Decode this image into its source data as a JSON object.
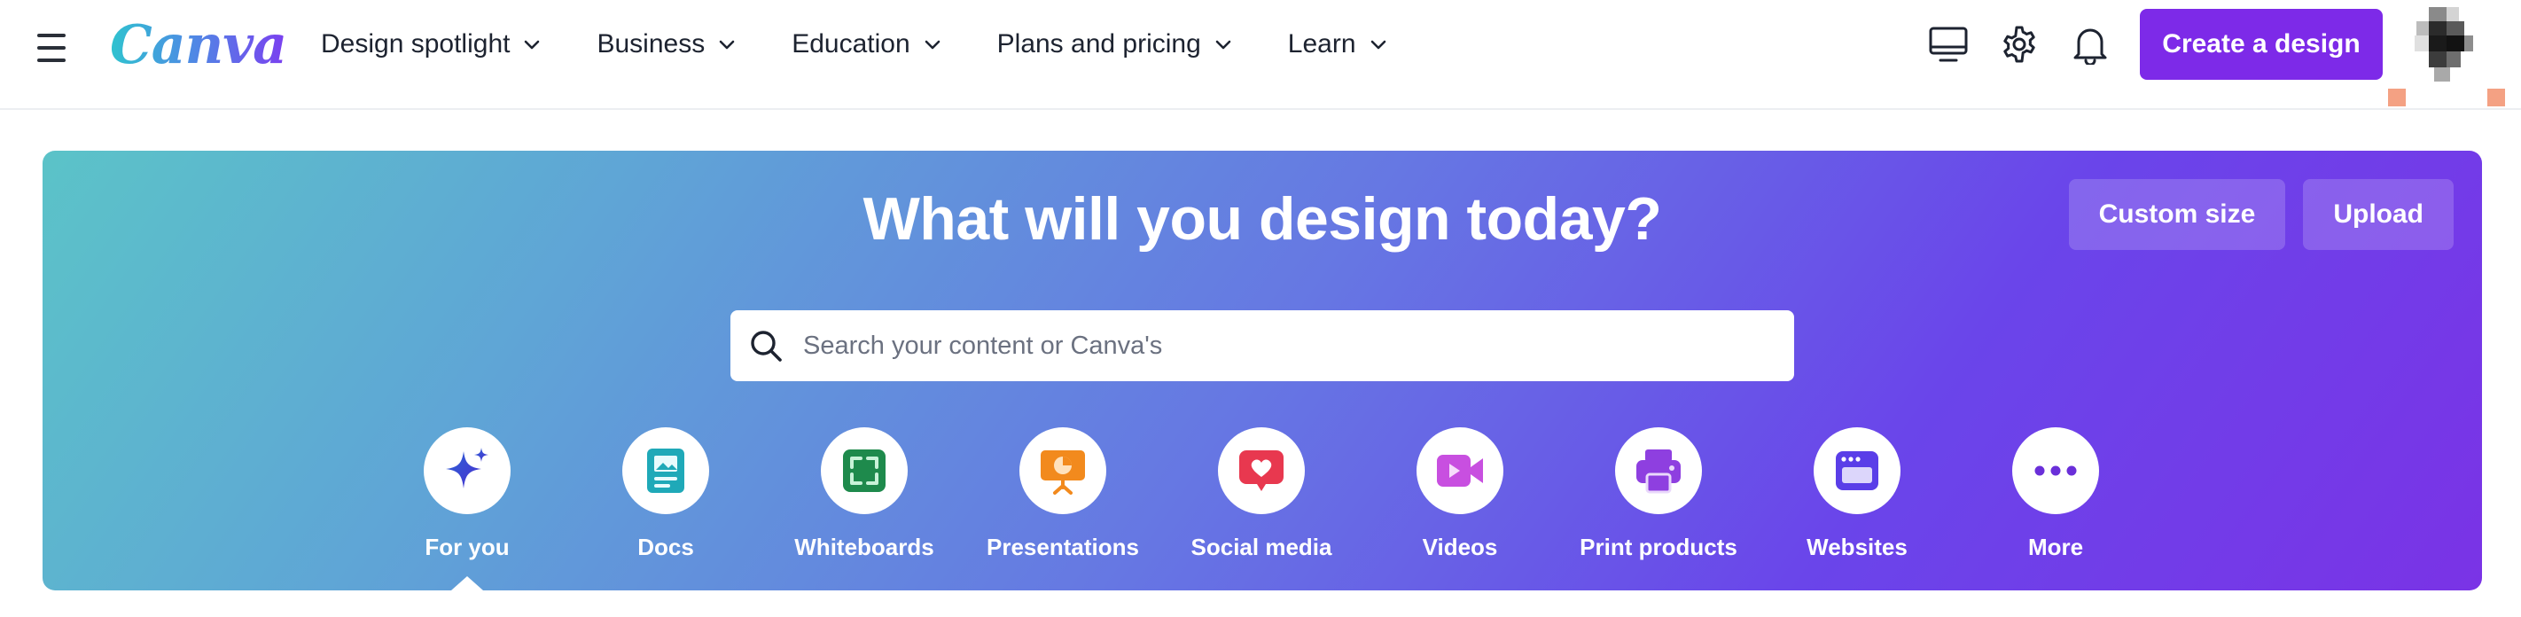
{
  "brand": {
    "logo_text": "Canva",
    "accent": "#7d2ae8"
  },
  "nav": {
    "items": [
      {
        "label": "Design spotlight"
      },
      {
        "label": "Business"
      },
      {
        "label": "Education"
      },
      {
        "label": "Plans and pricing"
      },
      {
        "label": "Learn"
      }
    ]
  },
  "header": {
    "icons": [
      "desktop-icon",
      "gear-icon",
      "bell-icon"
    ],
    "create_label": "Create a design"
  },
  "hero": {
    "title": "What will you design today?",
    "custom_size_label": "Custom size",
    "upload_label": "Upload",
    "search_placeholder": "Search your content or Canva's",
    "categories": [
      {
        "label": "For you",
        "icon": "sparkle-icon",
        "color": "#3b5bd9",
        "selected": true
      },
      {
        "label": "Docs",
        "icon": "doc-icon",
        "color": "#1fa9b8"
      },
      {
        "label": "Whiteboards",
        "icon": "whiteboard-icon",
        "color": "#1e8a4c"
      },
      {
        "label": "Presentations",
        "icon": "presentation-icon",
        "color": "#f28a1d"
      },
      {
        "label": "Social media",
        "icon": "heart-chat-icon",
        "color": "#e8384f"
      },
      {
        "label": "Videos",
        "icon": "video-icon",
        "color": "#c84fe0"
      },
      {
        "label": "Print products",
        "icon": "printer-icon",
        "color": "#8e3fe0"
      },
      {
        "label": "Websites",
        "icon": "website-icon",
        "color": "#5a3ee8"
      },
      {
        "label": "More",
        "icon": "more-icon",
        "color": "#6a2fd9"
      }
    ]
  }
}
